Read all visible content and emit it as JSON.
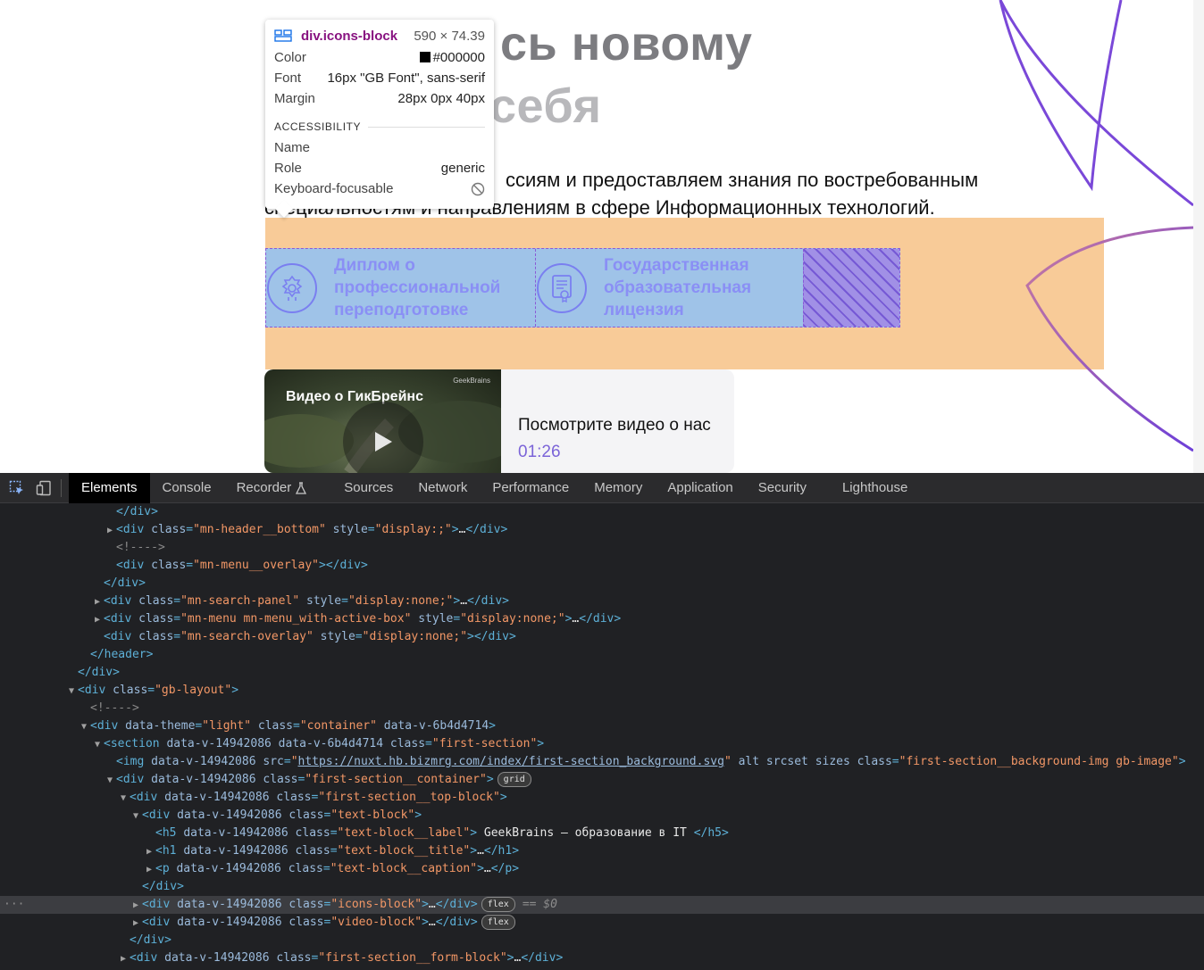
{
  "viewport": {
    "headline_1": "сь новому",
    "headline_2": "себя",
    "caption_line_1": "ссиям и предоставляем знания по востребованным",
    "caption_line_2": "специальностям и направлениям в сфере Информационных технологий.",
    "icons": [
      {
        "label": "Диплом о профессиональной переподготовке",
        "icon": "emblem-icon"
      },
      {
        "label": "Государственная образовательная лицензия",
        "icon": "certificate-icon"
      }
    ],
    "video": {
      "title": "Видео о ГикБрейнс",
      "badge": "GeekBrains",
      "text": "Посмотрите видео о нас",
      "duration": "01:26"
    }
  },
  "tooltip": {
    "element": "div.icons-block",
    "size": "590 × 74.39",
    "color_label": "Color",
    "color_value": "#000000",
    "font_label": "Font",
    "font_value": "16px \"GB Font\", sans-serif",
    "margin_label": "Margin",
    "margin_value": "28px 0px 40px",
    "accessibility_heading": "ACCESSIBILITY",
    "name_label": "Name",
    "role_label": "Role",
    "role_value": "generic",
    "keyboard_label": "Keyboard-focusable"
  },
  "devtools": {
    "tabs": [
      "Elements",
      "Console",
      "Recorder",
      "Sources",
      "Network",
      "Performance",
      "Memory",
      "Application",
      "Security",
      "Lighthouse"
    ],
    "active_tab": "Elements",
    "badges": {
      "grid": "grid",
      "flex": "flex"
    },
    "selected_marker": "== $0"
  },
  "colors": {
    "orange_band": "#f8cb98",
    "icons_block": "#9fc3e8",
    "accent_purple": "#7b64d8",
    "devtools_bg": "#202124"
  }
}
